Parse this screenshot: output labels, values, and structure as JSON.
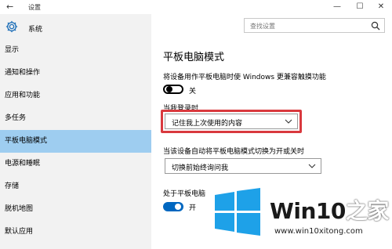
{
  "window": {
    "title": "设置",
    "back_icon": "←",
    "controls": [
      "—",
      "☐",
      "✕"
    ]
  },
  "sidebar": {
    "header_label": "系统",
    "items": [
      {
        "label": "显示",
        "active": false
      },
      {
        "label": "通知和操作",
        "active": false
      },
      {
        "label": "应用和功能",
        "active": false
      },
      {
        "label": "多任务",
        "active": false
      },
      {
        "label": "平板电脑模式",
        "active": true
      },
      {
        "label": "电源和睡眠",
        "active": false
      },
      {
        "label": "存储",
        "active": false
      },
      {
        "label": "脱机地图",
        "active": false
      },
      {
        "label": "默认应用",
        "active": false
      }
    ]
  },
  "search": {
    "placeholder": "查找设置"
  },
  "main": {
    "title": "平板电脑模式",
    "setting1": {
      "description": "将设备用作平板电脑时使 Windows 更兼容触摸功能",
      "state": "关",
      "on": false
    },
    "login": {
      "label": "当我登录时",
      "value": "记住我上次使用的内容"
    },
    "auto_switch": {
      "label": "当该设备自动将平板电脑模式切换为开或关时",
      "value": "切换前始终询问我"
    },
    "tablet_mode": {
      "label": "处于平板电脑",
      "state": "开",
      "on": true
    }
  },
  "watermark": {
    "brand_part1": "Win10",
    "brand_part2": "之家",
    "url": "www.win10xitong.com"
  },
  "colors": {
    "sidebar_bg": "#f2f2f2",
    "active_item": "#9ecdf0",
    "accent": "#0067c0",
    "highlight_border": "#d9393e",
    "logo_blue": "#1ea1e8"
  }
}
